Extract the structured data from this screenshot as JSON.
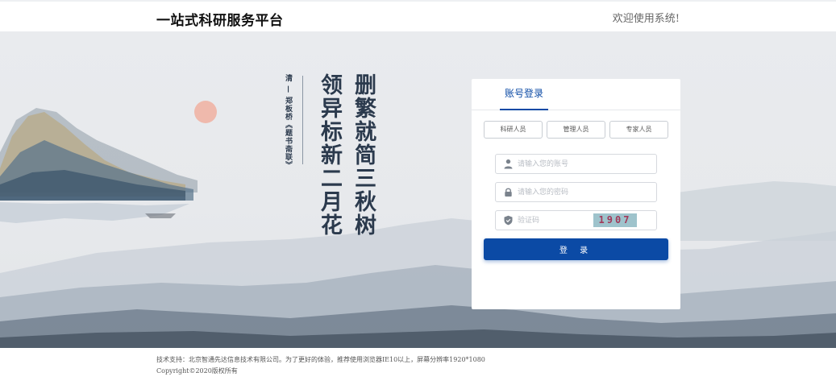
{
  "header": {
    "brand": "一站式科研服务平台",
    "welcome": "欢迎使用系统!"
  },
  "poem": {
    "line1": "删繁就简三秋树",
    "line2": "领异标新二月花",
    "author": "清 — 郑板桥《题书斋联》"
  },
  "login": {
    "tab": "账号登录",
    "roles": [
      "科研人员",
      "管理人员",
      "专家人员"
    ],
    "account_placeholder": "请输入您的账号",
    "password_placeholder": "请输入您的密码",
    "code_placeholder": "验证码",
    "captcha": "1907",
    "submit": "登 录"
  },
  "footer": {
    "support": "技术支持：北京智通先达信息技术有限公司。为了更好的体验，推荐使用浏览器IE10以上，屏幕分辨率1920*1080",
    "copyright": "Copyright©2020版权所有"
  },
  "colors": {
    "primary": "#0b4aa5",
    "sun": "#f0a090"
  }
}
